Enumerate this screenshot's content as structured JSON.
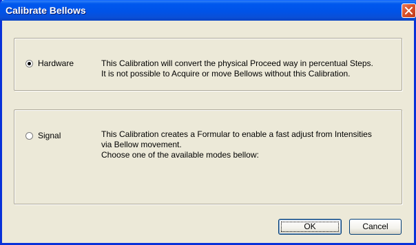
{
  "window": {
    "title": "Calibrate Bellows"
  },
  "icons": {
    "close": "close-icon"
  },
  "colors": {
    "titlebar": "#0053e8",
    "dialog_bg": "#ece9d8",
    "close_button": "#d9532b"
  },
  "hardware": {
    "radio_label": "Hardware",
    "selected": true,
    "description_line1": "This Calibration will convert the physical Proceed way in percentual Steps.",
    "description_line2": "It is not possible to Acquire or move Bellows without this Calibration."
  },
  "signal": {
    "radio_label": "Signal",
    "selected": false,
    "description_line1": "This Calibration creates a Formular to enable a fast adjust from Intensities",
    "description_line2": "via Bellow movement.",
    "description_line3": "Choose one of the available modes bellow:"
  },
  "buttons": {
    "ok_label": "OK",
    "cancel_label": "Cancel"
  }
}
